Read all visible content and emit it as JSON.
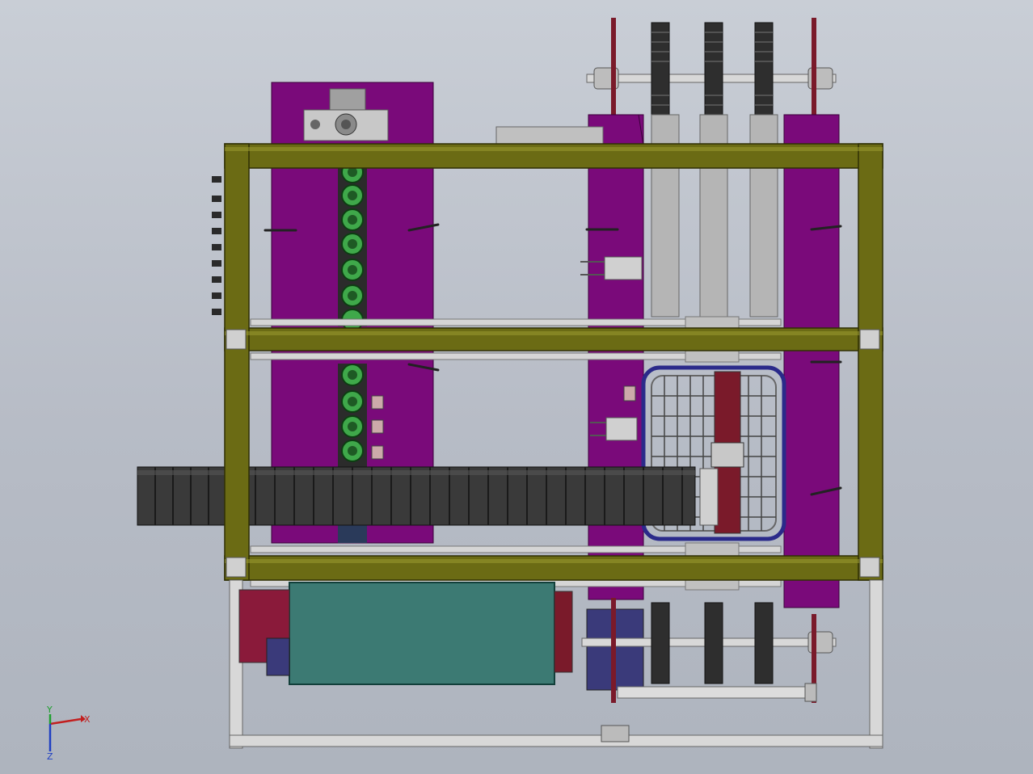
{
  "triad": {
    "x_label": "X",
    "y_label": "Y",
    "z_label": "Z"
  },
  "colors": {
    "background_top": "#c9ced6",
    "background_bottom": "#aeb4be",
    "frame_olive": "#6b6b14",
    "frame_olive_light": "#8a8a2a",
    "purple_panel": "#7a0a7a",
    "teal_box": "#3c7a73",
    "chain_dark": "#3a3a3a",
    "roller_green": "#2e7d32",
    "rail_grey": "#a9a9a9",
    "basket_blue": "#2a2a8a",
    "motor_blue": "#3a3a7a",
    "maroon": "#7a1a2a"
  }
}
